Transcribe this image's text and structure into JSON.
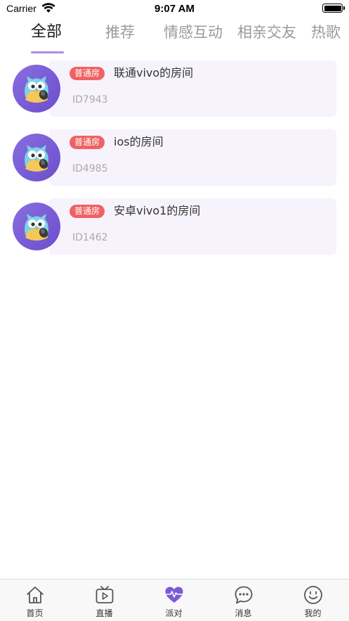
{
  "status_bar": {
    "carrier": "Carrier",
    "time": "9:07 AM"
  },
  "tabs": [
    {
      "label": "全部",
      "active": true
    },
    {
      "label": "推荐",
      "active": false
    },
    {
      "label": "情感互动",
      "active": false
    },
    {
      "label": "相亲交友",
      "active": false
    },
    {
      "label": "热歌",
      "active": false
    }
  ],
  "rooms": [
    {
      "badge": "普通房",
      "name": "联通vivo的房间",
      "id": "ID7943"
    },
    {
      "badge": "普通房",
      "name": "ios的房间",
      "id": "ID4985"
    },
    {
      "badge": "普通房",
      "name": "安卓vivo1的房间",
      "id": "ID1462"
    }
  ],
  "tab_bar": [
    {
      "label": "首页",
      "icon": "home-icon"
    },
    {
      "label": "直播",
      "icon": "tv-play-icon"
    },
    {
      "label": "派对",
      "icon": "heart-pulse-icon"
    },
    {
      "label": "消息",
      "icon": "chat-bubble-icon"
    },
    {
      "label": "我的",
      "icon": "smiley-icon"
    }
  ],
  "colors": {
    "accent": "#b08ae6",
    "badge": "#f06262",
    "card": "#f6f3fc",
    "party_icon": "#7b5ad6"
  }
}
